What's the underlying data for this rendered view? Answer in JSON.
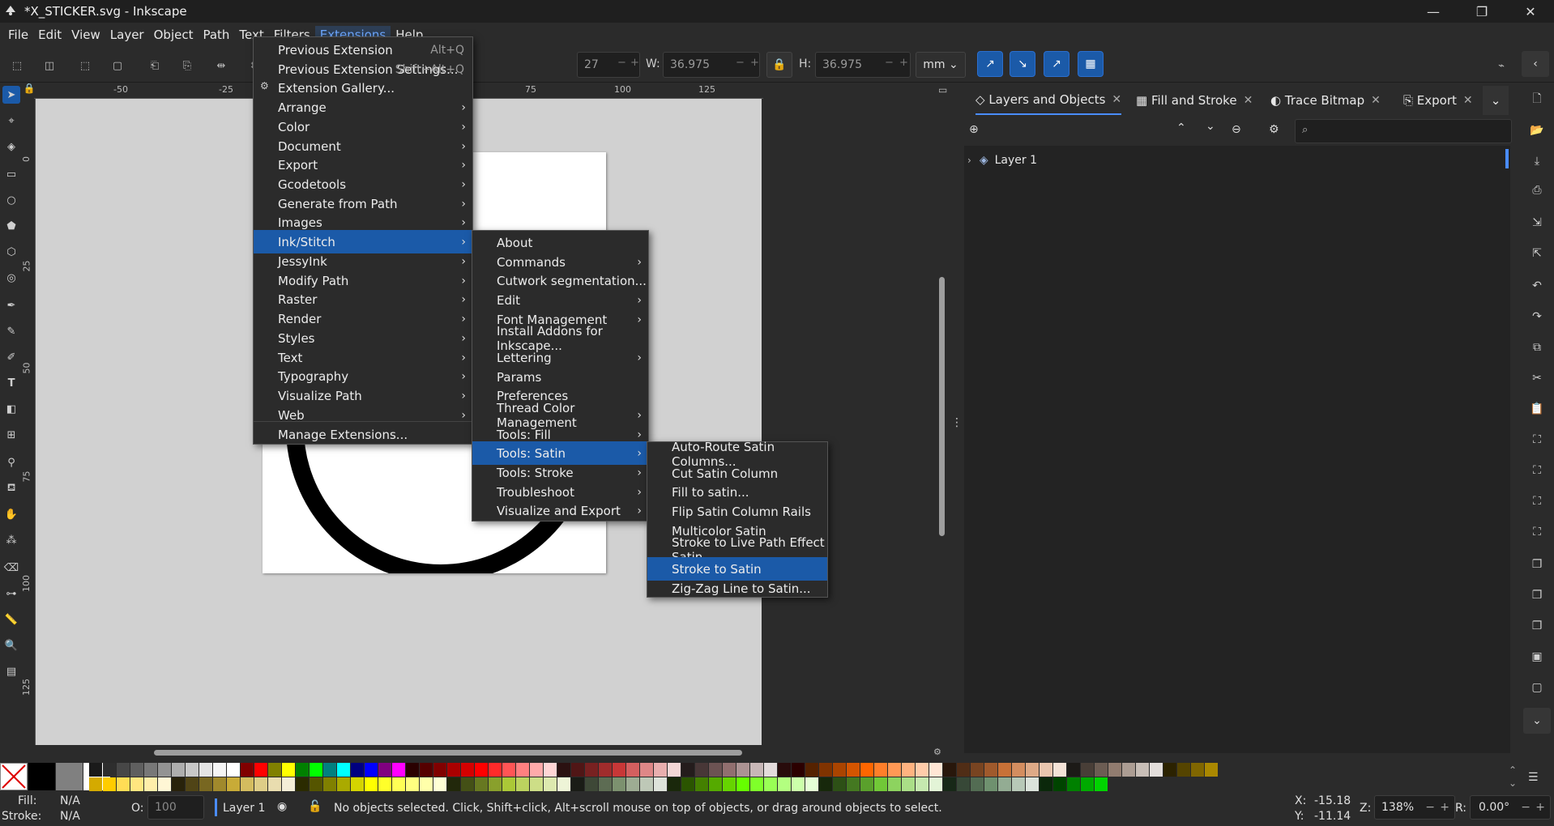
{
  "window": {
    "title": "*X_STICKER.svg - Inkscape",
    "minimize": "—",
    "restore": "❐",
    "close": "✕"
  },
  "menubar": [
    "File",
    "Edit",
    "View",
    "Layer",
    "Object",
    "Path",
    "Text",
    "Filters",
    "Extensions",
    "Help"
  ],
  "toolbar": {
    "x_partial": "27",
    "w_label": "W:",
    "w_value": "36.975",
    "h_label": "H:",
    "h_value": "36.975",
    "unit": "mm"
  },
  "ruler": {
    "h": [
      "-50",
      "-25",
      "75",
      "100",
      "125"
    ],
    "v": [
      "0",
      "25",
      "50",
      "75",
      "100",
      "125"
    ]
  },
  "extensions_menu": {
    "items": [
      {
        "label": "Previous Extension",
        "shortcut": "Alt+Q"
      },
      {
        "label": "Previous Extension Settings...",
        "shortcut": "Shift+Alt+Q"
      },
      {
        "label": "Extension Gallery..."
      },
      {
        "label": "Arrange",
        "submenu": true
      },
      {
        "label": "Color",
        "submenu": true
      },
      {
        "label": "Document",
        "submenu": true
      },
      {
        "label": "Export",
        "submenu": true
      },
      {
        "label": "Gcodetools",
        "submenu": true
      },
      {
        "label": "Generate from Path",
        "submenu": true
      },
      {
        "label": "Images",
        "submenu": true
      },
      {
        "label": "Ink/Stitch",
        "submenu": true,
        "highlighted": true
      },
      {
        "label": "JessyInk",
        "submenu": true
      },
      {
        "label": "Modify Path",
        "submenu": true
      },
      {
        "label": "Raster",
        "submenu": true
      },
      {
        "label": "Render",
        "submenu": true
      },
      {
        "label": "Styles",
        "submenu": true
      },
      {
        "label": "Text",
        "submenu": true
      },
      {
        "label": "Typography",
        "submenu": true
      },
      {
        "label": "Visualize Path",
        "submenu": true
      },
      {
        "label": "Web",
        "submenu": true
      },
      {
        "label": "Manage Extensions..."
      }
    ]
  },
  "inkstitch_menu": {
    "items": [
      {
        "label": "About"
      },
      {
        "label": "Commands",
        "submenu": true
      },
      {
        "label": "Cutwork segmentation..."
      },
      {
        "label": "Edit",
        "submenu": true
      },
      {
        "label": "Font Management",
        "submenu": true
      },
      {
        "label": "Install Addons for Inkscape..."
      },
      {
        "label": "Lettering",
        "submenu": true
      },
      {
        "label": "Params"
      },
      {
        "label": "Preferences"
      },
      {
        "label": "Thread Color Management",
        "submenu": true
      },
      {
        "label": "Tools: Fill",
        "submenu": true
      },
      {
        "label": "Tools: Satin",
        "submenu": true,
        "highlighted": true
      },
      {
        "label": "Tools: Stroke",
        "submenu": true
      },
      {
        "label": "Troubleshoot",
        "submenu": true
      },
      {
        "label": "Visualize and Export",
        "submenu": true
      }
    ]
  },
  "satin_menu": {
    "items": [
      {
        "label": "Auto-Route Satin Columns..."
      },
      {
        "label": "Cut Satin Column"
      },
      {
        "label": "Fill to satin..."
      },
      {
        "label": "Flip Satin Column Rails"
      },
      {
        "label": "Multicolor Satin"
      },
      {
        "label": "Stroke to Live Path Effect Satin..."
      },
      {
        "label": "Stroke to Satin",
        "highlighted": true
      },
      {
        "label": "Zig-Zag Line to Satin..."
      }
    ]
  },
  "dock": {
    "tabs": [
      {
        "label": "Layers and Objects",
        "icon": "layers-icon"
      },
      {
        "label": "Fill and Stroke",
        "icon": "fill-stroke-icon"
      },
      {
        "label": "Trace Bitmap",
        "icon": "trace-bitmap-icon"
      },
      {
        "label": "Export",
        "icon": "export-icon"
      }
    ],
    "layers": [
      {
        "label": "Layer 1"
      }
    ]
  },
  "palette": {
    "row1": [
      "#1a1a1a",
      "#2e2e2e",
      "#474747",
      "#5f5f5f",
      "#787878",
      "#939393",
      "#aeaeae",
      "#c8c8c8",
      "#e4e4e4",
      "#f5f5f5",
      "#ffffff",
      "#800000",
      "#ff0000",
      "#808000",
      "#ffff00",
      "#008000",
      "#00ff00",
      "#008080",
      "#00ffff",
      "#000080",
      "#0000ff",
      "#800080",
      "#ff00ff",
      "#2a0000",
      "#550000",
      "#800000",
      "#aa0000",
      "#d40000",
      "#ff0000",
      "#ff2a2a",
      "#ff5555",
      "#ff8080",
      "#ffaaaa",
      "#ffd5d5",
      "#2b1111",
      "#501616",
      "#782121",
      "#a02c2c",
      "#c83737",
      "#d35f5f",
      "#de8787",
      "#e9afaf",
      "#f4d7d7",
      "#241c1c",
      "#483737",
      "#6c5353",
      "#916f6f",
      "#ac9393",
      "#c8b7b7",
      "#e3dbdb",
      "#280b0b",
      "#2b0000",
      "#552200",
      "#803300",
      "#aa4400",
      "#d45500",
      "#ff6600",
      "#ff7f2a",
      "#ff9955",
      "#ffb380",
      "#ffccaa",
      "#ffe6d5",
      "#28170b",
      "#502d16",
      "#784421",
      "#a05a2c",
      "#c87137",
      "#d38d5f",
      "#deaa87",
      "#e9c6af",
      "#f4e3d7",
      "#1c1a17",
      "#483e37",
      "#6c5d53",
      "#917c6f",
      "#ac9d93",
      "#c8beb7",
      "#e3dedb",
      "#2b2200",
      "#554400",
      "#806600",
      "#aa8800"
    ],
    "row2": [
      "#d4aa00",
      "#ffcc00",
      "#ffdd55",
      "#ffe680",
      "#ffeeaa",
      "#fff6d5",
      "#28220b",
      "#504416",
      "#786721",
      "#a0892c",
      "#c8ab37",
      "#d3bc5f",
      "#decd87",
      "#e9ddaf",
      "#f4eed7",
      "#2b2b00",
      "#555500",
      "#808000",
      "#aaaa00",
      "#d4d400",
      "#ffff00",
      "#ffff2a",
      "#ffff55",
      "#ffff80",
      "#ffffaa",
      "#ffffd5",
      "#22280b",
      "#445016",
      "#677821",
      "#89a02c",
      "#abc837",
      "#bcd35f",
      "#cdde87",
      "#dde9af",
      "#eef4d7",
      "#1a1c16",
      "#3e4837",
      "#5d6c53",
      "#7c916f",
      "#9dac93",
      "#bec8b7",
      "#dee3db",
      "#1a280b",
      "#2b5500",
      "#448000",
      "#55aa00",
      "#66d400",
      "#66ff00",
      "#7fff2a",
      "#99ff55",
      "#b3ff80",
      "#ccffaa",
      "#e5ffd5",
      "#17280b",
      "#2d5016",
      "#447821",
      "#5aa02c",
      "#71c837",
      "#8dd35f",
      "#aade87",
      "#c6e9af",
      "#e3f4d7",
      "#172817",
      "#374837",
      "#536c53",
      "#6f916f",
      "#93ac93",
      "#b7c8b7",
      "#dbe3db",
      "#0b280b",
      "#004400",
      "#008000",
      "#00aa00",
      "#00d400"
    ]
  },
  "status": {
    "fill_label": "Fill:",
    "fill_value": "N/A",
    "stroke_label": "Stroke:",
    "stroke_value": "N/A",
    "opacity_label": "O:",
    "opacity_value": "100",
    "layer": "Layer 1",
    "message": "No objects selected. Click, Shift+click, Alt+scroll mouse on top of objects, or drag around objects to select.",
    "x_label": "X:",
    "x_value": "-15.18",
    "y_label": "Y:",
    "y_value": "-11.14",
    "zoom_label": "Z:",
    "zoom_value": "138%",
    "rot_label": "R:",
    "rot_value": "0.00°"
  }
}
